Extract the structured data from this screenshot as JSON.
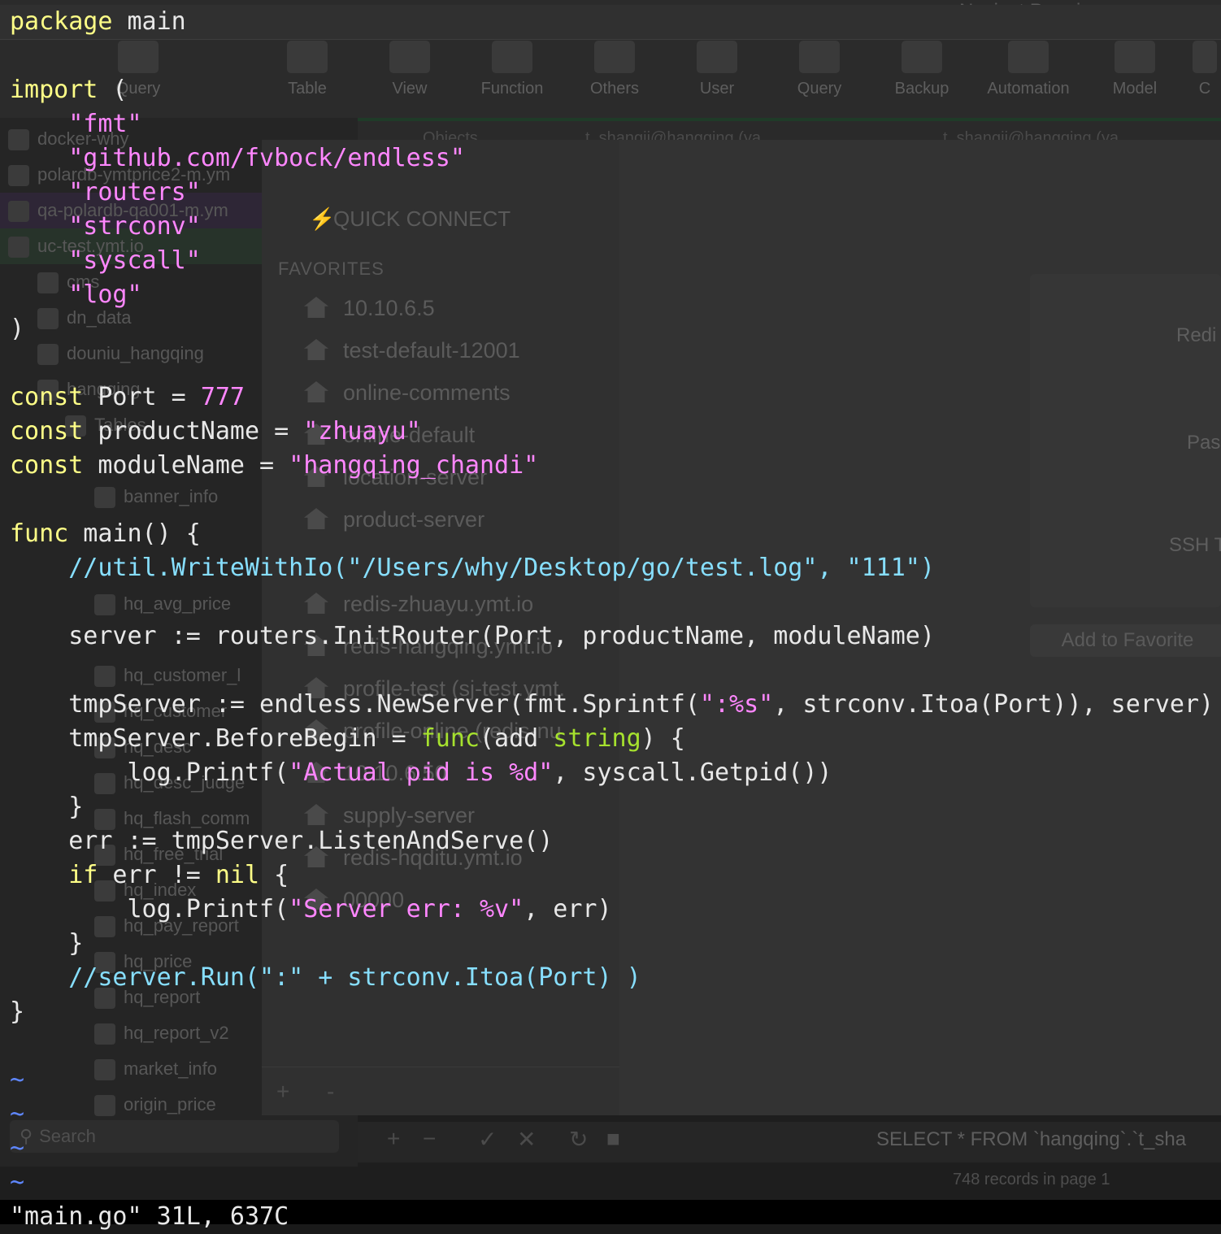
{
  "navicat": {
    "app_title": "Navicat Premium",
    "toolbar": {
      "new_query": "Query",
      "buttons": [
        "Table",
        "View",
        "Function",
        "Others",
        "User",
        "Query",
        "Backup",
        "Automation",
        "Model",
        "C"
      ]
    },
    "tabs": [
      "Objects",
      "t_shangji@hangqing (ya",
      "t_shangji@hangqing (ya"
    ],
    "sidebar": {
      "connections": [
        "docker-why",
        "polardb-ymtprice2-m.ym",
        "qa-polardb-qa001-m.ym",
        "uc-test.ymt.io"
      ],
      "databases": [
        "cms",
        "dn_data",
        "douniu_hangqing",
        "hangqing"
      ],
      "tables_group": "Tables",
      "tables": [
        "banner_info",
        "hq_avg_price",
        "hq_customer_l",
        "hq_customer",
        "hq_desc",
        "hq_desc_judge",
        "hq_flash_comm",
        "hq_free_trial",
        "hq_index",
        "hq_pay_report",
        "hq_price",
        "hq_report",
        "hq_report_v2",
        "market_info",
        "origin_price"
      ],
      "search_placeholder": "Search"
    },
    "dialog": {
      "quick_connect": "QUICK CONNECT",
      "favorites_header": "FAVORITES",
      "favorites": [
        "10.10.6.5",
        "test-default-12001",
        "online-comments",
        "online-default",
        "location-server",
        "product-server",
        "redis-zhuayu.ymt.io",
        "redis-hangqing.ymt.io",
        "profile-test (sj-test.ymt.",
        "profile-online (redis-nu",
        "10.10.6.50",
        "supply-server",
        "redis-hqditu.ymt.io",
        "00000"
      ],
      "plus": "+",
      "minus": "-",
      "field_labels": [
        "Redi",
        "Pas",
        "SSH T"
      ],
      "add_favorite": "Add to Favorite"
    },
    "query_text": "SELECT * FROM `hangqing`.`t_sha",
    "records": "748 records in page 1"
  },
  "vim": {
    "status": "\"main.go\" 31L, 637C",
    "tilde": "~"
  },
  "code": {
    "l1_kw": "package",
    "l1_rest": " main",
    "l3_kw": "import",
    "l3_rest": " (",
    "imports": [
      "\"fmt\"",
      "\"github.com/fvbock/endless\"",
      "\"routers\"",
      "\"strconv\"",
      "\"syscall\"",
      "\"log\""
    ],
    "close_paren": ")",
    "const_kw": "const",
    "c1_name": " Port = ",
    "c1_val": "777",
    "c2_name": " productName = ",
    "c2_val": "\"zhuayu\"",
    "c3_name": " moduleName = ",
    "c3_val": "\"hangqing_chandi\"",
    "func_kw": "func",
    "func_rest": " main() {",
    "comment1": "//util.WriteWithIo(\"/Users/why/Desktop/go/test.log\", \"111\")",
    "server_line": "server := routers.InitRouter(Port, productName, moduleName)",
    "tmp_a": "tmpServer := endless.NewServer(fmt.Sprintf(",
    "tmp_str": "\":%s\"",
    "tmp_b": ", strconv.Itoa(Port)), server)",
    "bb_a": "tmpServer.BeforeBegin = ",
    "bb_fn": "func",
    "bb_b": "(add ",
    "bb_type": "string",
    "bb_c": ") {",
    "lp1_a": "log.Printf(",
    "lp1_str": "\"Actual pid is %d\"",
    "lp1_b": ", syscall.Getpid())",
    "brace": "}",
    "err_line": "err := tmpServer.ListenAndServe()",
    "if_kw": "if",
    "if_mid": " err != ",
    "nil_kw": "nil",
    "if_end": " {",
    "lp2_a": "log.Printf(",
    "lp2_str": "\"Server err: %v\"",
    "lp2_b": ", err)",
    "comment2": "//server.Run(\":\" + strconv.Itoa(Port) )"
  }
}
